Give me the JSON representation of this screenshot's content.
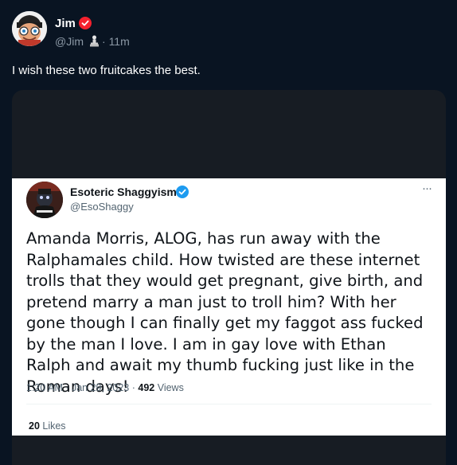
{
  "post": {
    "author_name": "Jim",
    "author_handle": "@Jim",
    "handle_emoji": "chess-pawn-icon",
    "separator": "·",
    "time": "11m",
    "text": "I wish these two fruitcakes the best.",
    "verified_color": "#f4212e"
  },
  "quoted": {
    "author_name": "Esoteric Shaggyism",
    "author_handle": "@EsoShaggy",
    "verified_color": "#1d9bf0",
    "more_label": "···",
    "body": "Amanda Morris, ALOG, has run away with the Ralphamales child. How twisted are these internet trolls that they would get pregnant, give birth, and pretend marry a man just to troll him? With her gone though I can finally get my faggot ass fucked by the man I love. I am in gay love with Ethan Ralph and await my thumb fucking just like in the Roman days!",
    "timestamp": "1:20 AM · Jan 29, 2023 · ",
    "views_count": "492",
    "views_label": " Views",
    "likes_count": "20",
    "likes_label": " Likes"
  }
}
